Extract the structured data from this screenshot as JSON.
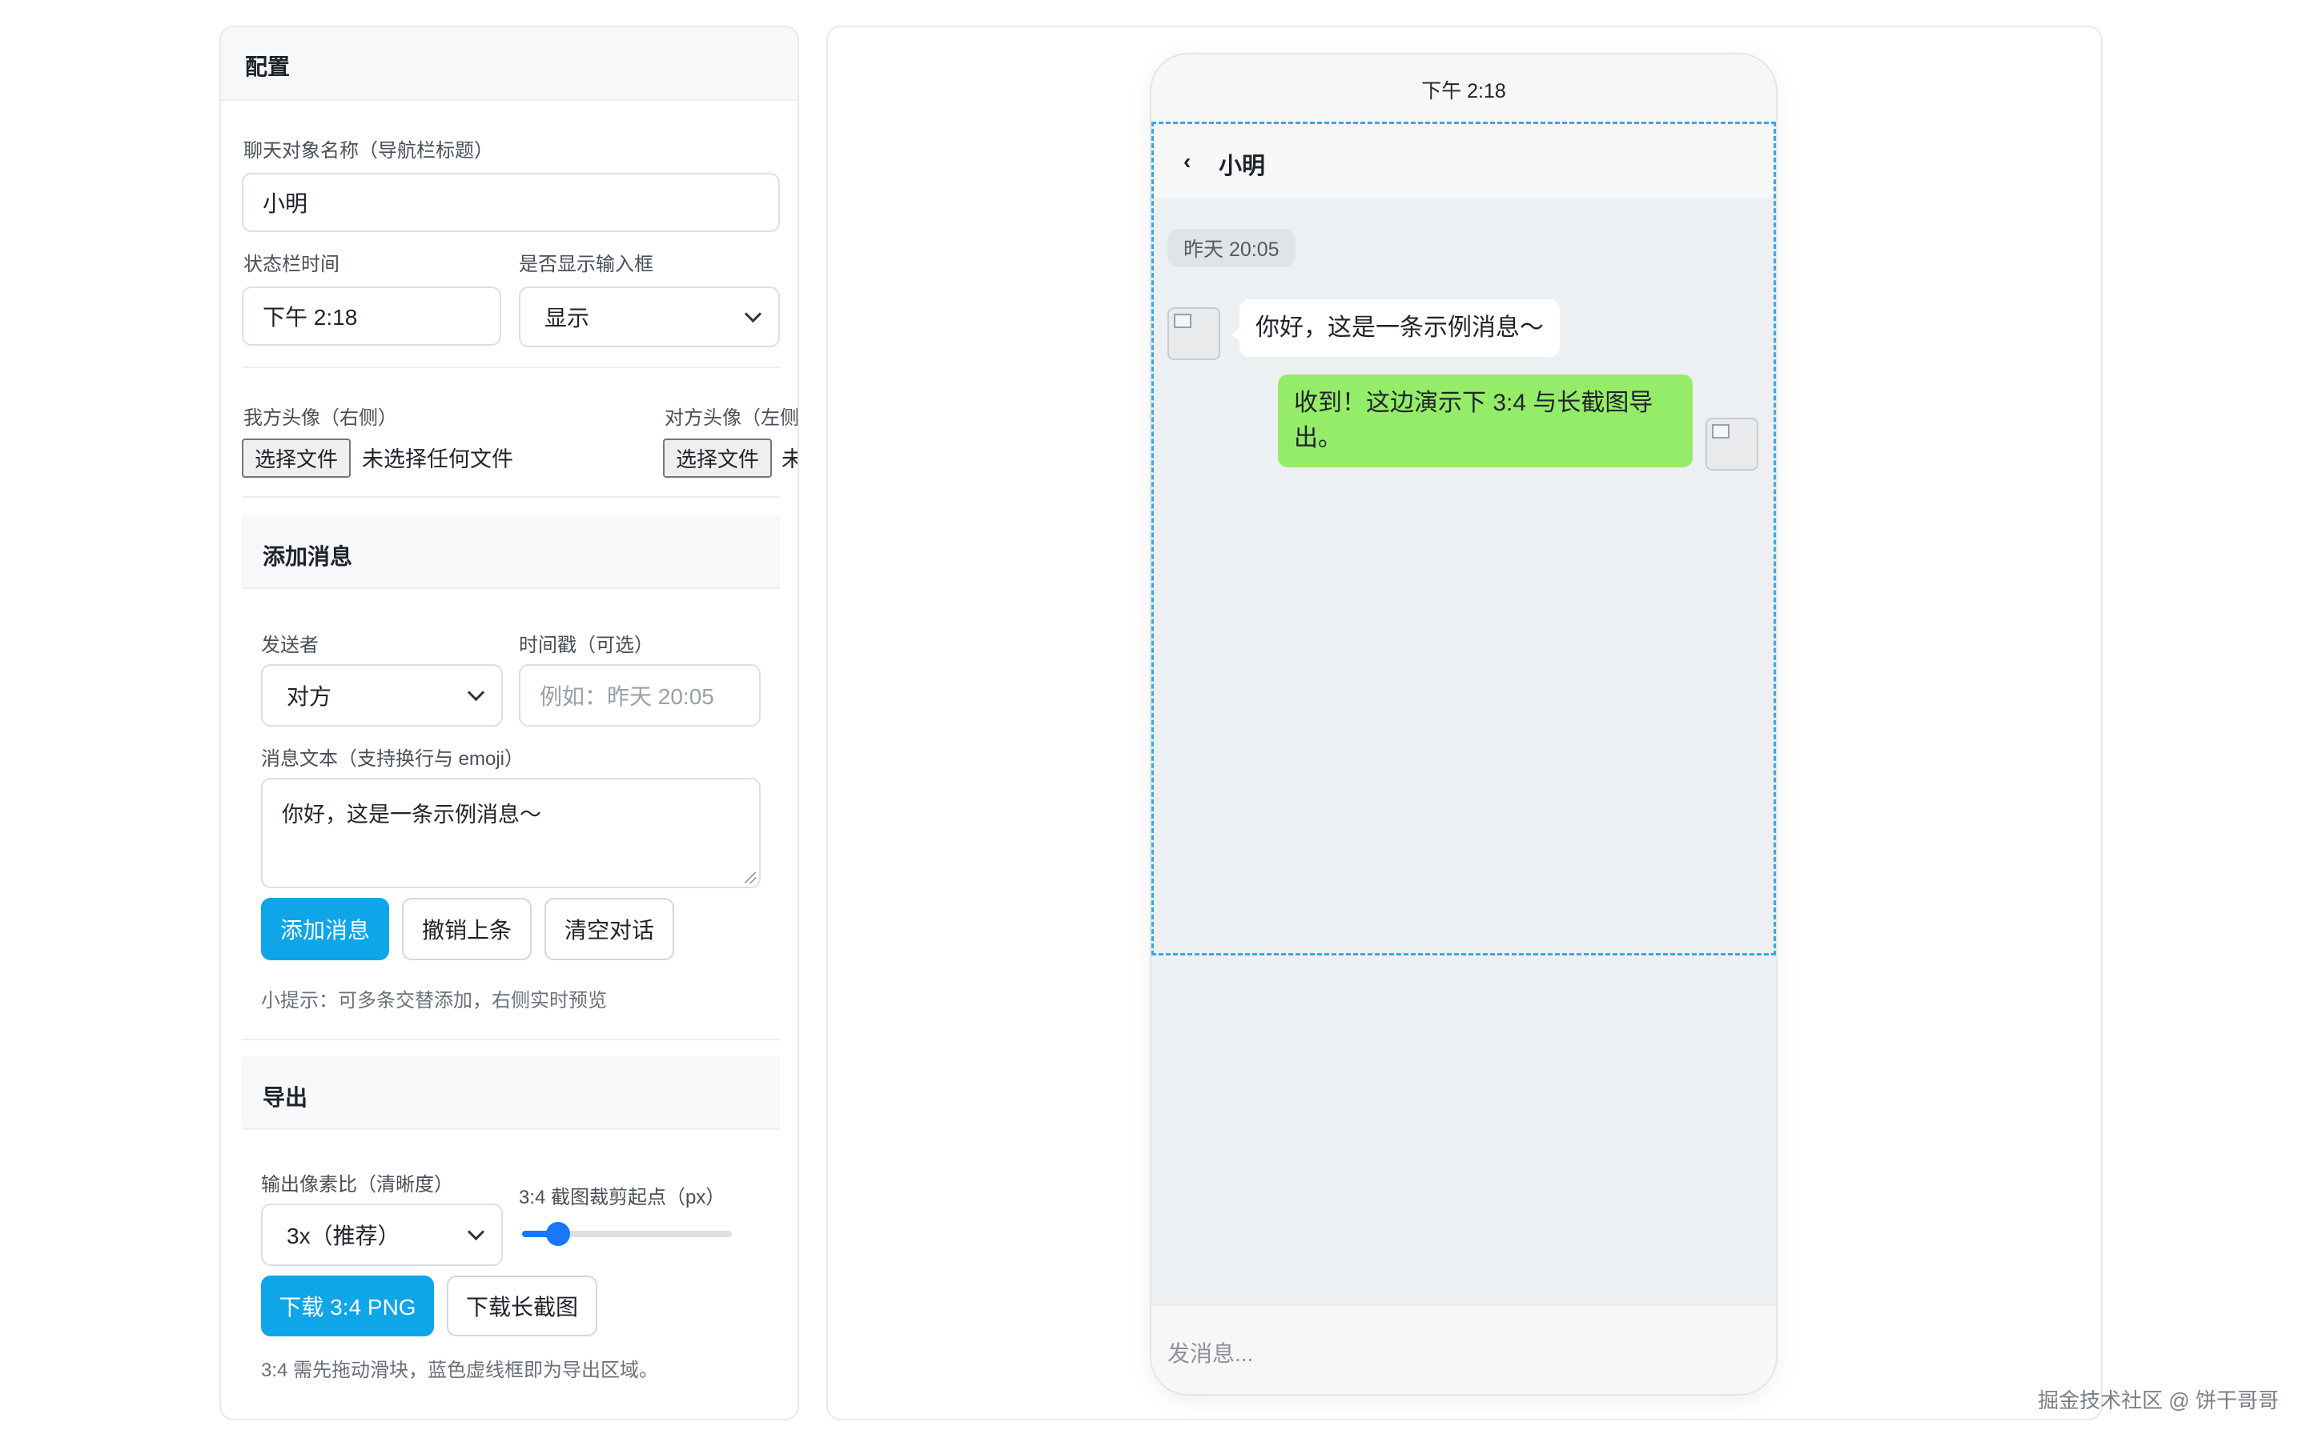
{
  "config": {
    "title": "配置",
    "chat_name_label": "聊天对象名称（导航栏标题）",
    "chat_name_value": "小明",
    "status_time_label": "状态栏时间",
    "status_time_value": "下午 2:18",
    "show_input_label": "是否显示输入框",
    "show_input_value": "显示",
    "my_avatar_label": "我方头像（右侧）",
    "my_avatar_button": "选择文件",
    "my_avatar_file": "未选择任何文件",
    "other_avatar_label": "对方头像（左侧",
    "other_avatar_button": "选择文件",
    "other_avatar_file": "未"
  },
  "add_message": {
    "title": "添加消息",
    "sender_label": "发送者",
    "sender_value": "对方",
    "timestamp_label": "时间戳（可选）",
    "timestamp_placeholder": "例如：昨天 20:05",
    "text_label": "消息文本（支持换行与 emoji）",
    "text_value": "你好，这是一条示例消息～",
    "add_button": "添加消息",
    "undo_button": "撤销上条",
    "clear_button": "清空对话",
    "hint": "小提示：可多条交替添加，右侧实时预览"
  },
  "export": {
    "title": "导出",
    "pixel_ratio_label": "输出像素比（清晰度）",
    "pixel_ratio_value": "3x（推荐）",
    "crop_label": "3:4 截图裁剪起点（px）",
    "crop_slider_fraction": 0.17,
    "download_34_button": "下载 3:4 PNG",
    "download_long_button": "下载长截图",
    "hint": "3:4 需先拖动滑块，蓝色虚线框即为导出区域。"
  },
  "phone": {
    "status_time": "下午 2:18",
    "back_glyph": "‹",
    "nav_title": "小明",
    "timestamp": "昨天 20:05",
    "messages": [
      {
        "side": "left",
        "text": "你好，这是一条示例消息～"
      },
      {
        "side": "right",
        "text_line1": "收到！这边演示下 3:4 与长截图导",
        "text_line2": "出。"
      }
    ],
    "input_placeholder": "发消息..."
  },
  "colors": {
    "accent": "#0ea5e9",
    "bubble_green": "#95ec69",
    "crop_border": "#3ba8e0",
    "slider": "#1677ff"
  },
  "watermark": "掘金技术社区 @ 饼干哥哥"
}
